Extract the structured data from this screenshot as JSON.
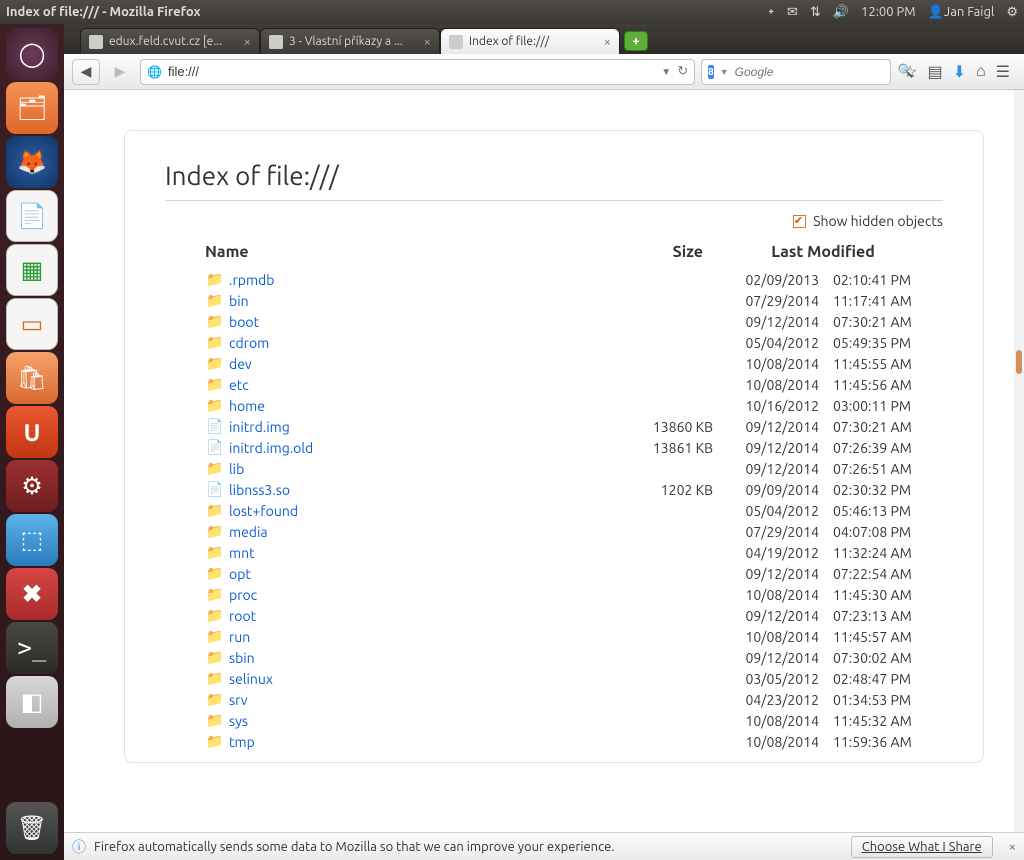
{
  "menubar": {
    "title": "Index of file:/// - Mozilla Firefox",
    "clock": "12:00 PM",
    "user": "Jan Faigl"
  },
  "tabs": {
    "items": [
      {
        "label": "edux.feld.cvut.cz [e..."
      },
      {
        "label": "3 - Vlastní příkazy a ..."
      },
      {
        "label": "Index of file:///"
      }
    ],
    "active_index": 2
  },
  "urlbar": {
    "value": "file:///"
  },
  "searchbox": {
    "placeholder": "Google"
  },
  "page": {
    "heading": "Index of file:///",
    "show_hidden_label": "Show hidden objects",
    "columns": {
      "name": "Name",
      "size": "Size",
      "modified": "Last Modified"
    },
    "rows": [
      {
        "type": "folder",
        "name": ".rpmdb",
        "size": "",
        "date": "02/09/2013",
        "time": "02:10:41 PM"
      },
      {
        "type": "folder",
        "name": "bin",
        "size": "",
        "date": "07/29/2014",
        "time": "11:17:41 AM"
      },
      {
        "type": "folder",
        "name": "boot",
        "size": "",
        "date": "09/12/2014",
        "time": "07:30:21 AM"
      },
      {
        "type": "folder",
        "name": "cdrom",
        "size": "",
        "date": "05/04/2012",
        "time": "05:49:35 PM"
      },
      {
        "type": "folder",
        "name": "dev",
        "size": "",
        "date": "10/08/2014",
        "time": "11:45:55 AM"
      },
      {
        "type": "folder",
        "name": "etc",
        "size": "",
        "date": "10/08/2014",
        "time": "11:45:56 AM"
      },
      {
        "type": "folder",
        "name": "home",
        "size": "",
        "date": "10/16/2012",
        "time": "03:00:11 PM"
      },
      {
        "type": "file",
        "name": "initrd.img",
        "size": "13860 KB",
        "date": "09/12/2014",
        "time": "07:30:21 AM"
      },
      {
        "type": "file",
        "name": "initrd.img.old",
        "size": "13861 KB",
        "date": "09/12/2014",
        "time": "07:26:39 AM"
      },
      {
        "type": "folder",
        "name": "lib",
        "size": "",
        "date": "09/12/2014",
        "time": "07:26:51 AM"
      },
      {
        "type": "file",
        "name": "libnss3.so",
        "size": "1202 KB",
        "date": "09/09/2014",
        "time": "02:30:32 PM"
      },
      {
        "type": "folder",
        "name": "lost+found",
        "size": "",
        "date": "05/04/2012",
        "time": "05:46:13 PM"
      },
      {
        "type": "folder",
        "name": "media",
        "size": "",
        "date": "07/29/2014",
        "time": "04:07:08 PM"
      },
      {
        "type": "folder",
        "name": "mnt",
        "size": "",
        "date": "04/19/2012",
        "time": "11:32:24 AM"
      },
      {
        "type": "folder",
        "name": "opt",
        "size": "",
        "date": "09/12/2014",
        "time": "07:22:54 AM"
      },
      {
        "type": "folder",
        "name": "proc",
        "size": "",
        "date": "10/08/2014",
        "time": "11:45:30 AM"
      },
      {
        "type": "folder",
        "name": "root",
        "size": "",
        "date": "09/12/2014",
        "time": "07:23:13 AM"
      },
      {
        "type": "folder",
        "name": "run",
        "size": "",
        "date": "10/08/2014",
        "time": "11:45:57 AM"
      },
      {
        "type": "folder",
        "name": "sbin",
        "size": "",
        "date": "09/12/2014",
        "time": "07:30:02 AM"
      },
      {
        "type": "folder",
        "name": "selinux",
        "size": "",
        "date": "03/05/2012",
        "time": "02:48:47 PM"
      },
      {
        "type": "folder",
        "name": "srv",
        "size": "",
        "date": "04/23/2012",
        "time": "01:34:53 PM"
      },
      {
        "type": "folder",
        "name": "sys",
        "size": "",
        "date": "10/08/2014",
        "time": "11:45:32 AM"
      },
      {
        "type": "folder",
        "name": "tmp",
        "size": "",
        "date": "10/08/2014",
        "time": "11:59:36 AM"
      }
    ]
  },
  "infobar": {
    "text": "Firefox automatically sends some data to Mozilla so that we can improve your experience.",
    "button": "Choose What I Share"
  }
}
